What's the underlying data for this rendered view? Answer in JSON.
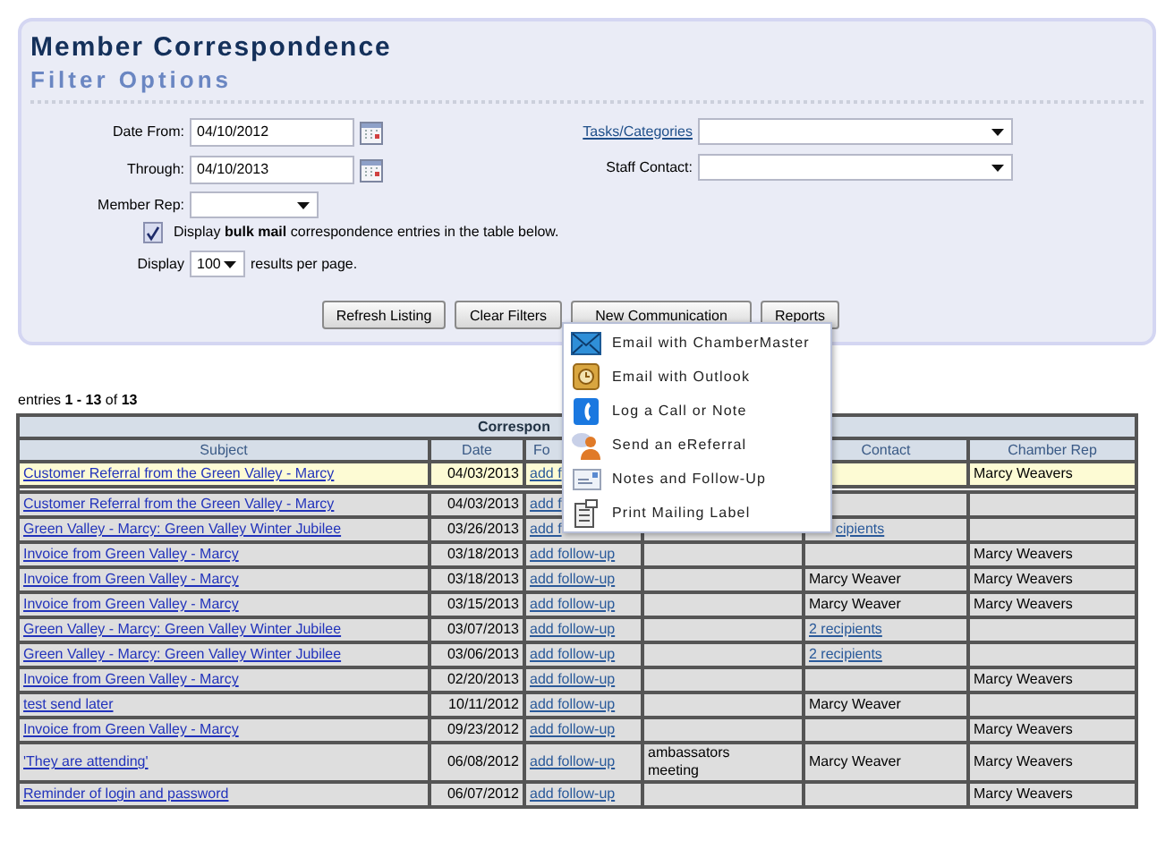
{
  "title": "Member Correspondence",
  "subtitle": "Filter Options",
  "filters": {
    "date_from": {
      "label": "Date From:",
      "value": "04/10/2012"
    },
    "through": {
      "label": "Through:",
      "value": "04/10/2013"
    },
    "member_rep": {
      "label": "Member Rep:"
    },
    "tasks_categories": {
      "label": "Tasks/Categories"
    },
    "staff_contact": {
      "label": "Staff Contact:"
    },
    "bulk_mail": {
      "checked": true,
      "label": "Display **bulk mail** correspondence entries in the table below."
    },
    "display": {
      "label": "Display",
      "value": "100",
      "suffix": "results per page."
    }
  },
  "buttons": [
    "Refresh Listing",
    "Clear Filters",
    "New Communication",
    "Reports"
  ],
  "menu": [
    "Email with ChamberMaster",
    "Email with Outlook",
    "Log a Call or Note",
    "Send an eReferral",
    "Notes and Follow-Up",
    "Print Mailing Label"
  ],
  "entries": "entries **1 - 13** of **13**",
  "table": {
    "group_header": "Correspon",
    "columns": [
      {
        "label": "Subject"
      },
      {
        "label": "Date"
      },
      {
        "label": "Fo"
      },
      {},
      {
        "label": "Contact"
      },
      {
        "label": "Chamber Rep"
      }
    ],
    "rows": [
      {
        "selected": true,
        "subject": "Customer Referral from the Green Valley - Marcy",
        "date": "04/03/2013",
        "follow_up": "add f",
        "chamber_rep": "Marcy Weavers"
      },
      {
        "selected": false,
        "subject": "Customer Referral from the Green Valley - Marcy",
        "date": "04/03/2013",
        "follow_up": "add f"
      },
      {
        "selected": false,
        "subject": "Green Valley - Marcy: Green Valley Winter Jubilee",
        "date": "03/26/2013",
        "follow_up": "add f",
        "contact": "cipients",
        "contact_link": true
      },
      {
        "selected": false,
        "subject": "Invoice from Green Valley - Marcy",
        "date": "03/18/2013",
        "follow_up": "add follow-up",
        "chamber_rep": "Marcy Weavers"
      },
      {
        "selected": false,
        "subject": "Invoice from Green Valley - Marcy",
        "date": "03/18/2013",
        "follow_up": "add follow-up",
        "contact": "Marcy Weaver",
        "contact_link": false,
        "chamber_rep": "Marcy Weavers"
      },
      {
        "selected": false,
        "subject": "Invoice from Green Valley - Marcy",
        "date": "03/15/2013",
        "follow_up": "add follow-up",
        "contact": "Marcy Weaver",
        "contact_link": false,
        "chamber_rep": "Marcy Weavers"
      },
      {
        "selected": false,
        "subject": "Green Valley - Marcy: Green Valley Winter Jubilee",
        "date": "03/07/2013",
        "follow_up": "add follow-up",
        "contact": "2 recipients",
        "contact_link": true
      },
      {
        "selected": false,
        "subject": "Green Valley - Marcy: Green Valley Winter Jubilee",
        "date": "03/06/2013",
        "follow_up": "add follow-up",
        "contact": "2 recipients",
        "contact_link": true
      },
      {
        "selected": false,
        "subject": "Invoice from Green Valley - Marcy",
        "date": "02/20/2013",
        "follow_up": "add follow-up",
        "chamber_rep": "Marcy Weavers"
      },
      {
        "selected": false,
        "subject": "test send later",
        "date": "10/11/2012",
        "follow_up": "add follow-up",
        "contact": "Marcy Weaver",
        "contact_link": false
      },
      {
        "selected": false,
        "subject": "Invoice from Green Valley - Marcy",
        "date": "09/23/2012",
        "follow_up": "add follow-up",
        "chamber_rep": "Marcy Weavers"
      },
      {
        "selected": false,
        "subject": "'They are attending'",
        "date": "06/08/2012",
        "follow_up": "add follow-up",
        "column_4": "ambassators meeting",
        "contact": "Marcy Weaver",
        "contact_link": false,
        "chamber_rep": "Marcy Weavers"
      },
      {
        "selected": false,
        "subject": "Reminder of login and password",
        "date": "06/07/2012",
        "follow_up": "add follow-up",
        "chamber_rep": "Marcy Weavers"
      }
    ]
  }
}
